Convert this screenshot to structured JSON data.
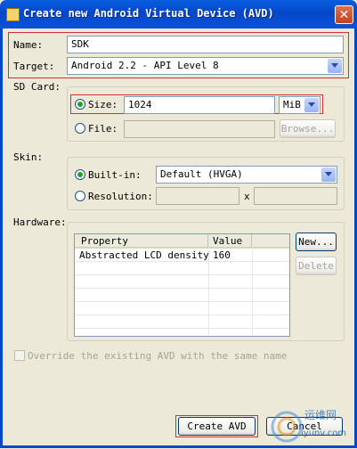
{
  "window": {
    "title": "Create new Android Virtual Device (AVD)",
    "close_glyph": "✕"
  },
  "name": {
    "label": "Name:",
    "value": "SDK"
  },
  "target": {
    "label": "Target:",
    "value": "Android 2.2 - API Level 8"
  },
  "sdcard": {
    "group_label": "SD Card:",
    "size_label": "Size:",
    "size_value": "1024",
    "unit_value": "MiB",
    "file_label": "File:",
    "file_value": "",
    "browse_label": "Browse..."
  },
  "skin": {
    "group_label": "Skin:",
    "builtin_label": "Built-in:",
    "builtin_value": "Default (HVGA)",
    "resolution_label": "Resolution:",
    "res_x": "",
    "res_separator": "x",
    "res_y": ""
  },
  "hardware": {
    "group_label": "Hardware:",
    "columns": [
      "Property",
      "Value"
    ],
    "rows": [
      {
        "property": "Abstracted LCD density",
        "value": "160"
      }
    ],
    "new_label": "New...",
    "delete_label": "Delete"
  },
  "override": {
    "label": "Override the existing AVD with the same name",
    "checked": false
  },
  "footer": {
    "create_label": "Create AVD",
    "cancel_label": "Cancel"
  },
  "watermark": {
    "text": "运维网",
    "url": "iyunv.com"
  }
}
